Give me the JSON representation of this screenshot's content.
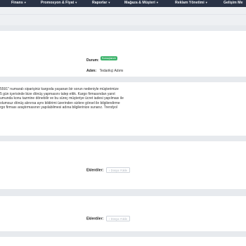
{
  "nav": {
    "items": [
      {
        "label": "Finans"
      },
      {
        "label": "Promosyon & Fiyat"
      },
      {
        "label": "Raporlar"
      },
      {
        "label": "Mağaza & Müşteri"
      },
      {
        "label": "Reklam Yönetimi"
      },
      {
        "label": "Gelişim Me"
      }
    ]
  },
  "status": {
    "durum_label": "Durum:",
    "durum_value": "Sonuçlandı",
    "adim_label": "Adım:",
    "adim_value": "Tedarikçi Adımı"
  },
  "message": {
    "lines": [
      "5591\" numaralı siparişiniz kargoda yaşanan bir sorun nedeniyle müşterimize",
      " 5 gün içerisinde bize dönüş yapmasını talep ettik. Kargo firmasından yanıt",
      "umunda konu tazmine dönebilir ve bu süreç müşteriye ücret iadesi yapılması ile",
      " olumsuz dönüş alınırsa aynı bildirimi üzerinden sizlere görsel ile bilgilendirme",
      "rgo firması araştırmasının yapılabilmesi adına bilgilerinize sunarız. Trendyol"
    ]
  },
  "attachments": [
    {
      "label": "Eklentiler:",
      "upload_label": "Dosya Yükle"
    },
    {
      "label": "Eklentiler:",
      "upload_label": "Dosya Yükle"
    }
  ]
}
